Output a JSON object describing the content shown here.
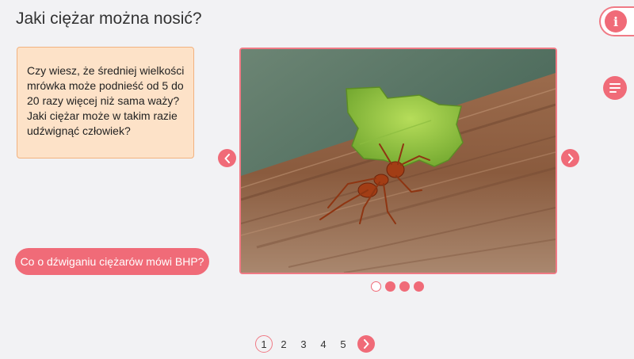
{
  "header": {
    "title": "Jaki ciężar można nosić?",
    "info_icon": "info-icon",
    "info_glyph": "i",
    "menu_icon": "hamburger-menu-icon"
  },
  "info_card": {
    "text": "Czy wiesz, że średniej wielkości mrówka może podnieść od 5 do 20 razy więcej niż sama waży? Jaki ciężar może w takim razie udźwignąć człowiek?"
  },
  "bhp_button": {
    "label": "Co o dźwiganiu ciężarów mówi BHP?"
  },
  "carousel": {
    "image_icon": "ant-carrying-leaf-image",
    "prev_icon": "chevron-left-icon",
    "next_icon": "chevron-right-icon",
    "slide_count": 4,
    "active_slide": 1
  },
  "pagination": {
    "pages": [
      "1",
      "2",
      "3",
      "4",
      "5"
    ],
    "current": "1",
    "next_icon": "chevron-right-icon"
  },
  "colors": {
    "accent": "#f06b78",
    "card_bg": "#fde2c8",
    "card_border": "#f2b27f",
    "page_bg": "#f2f2f4"
  }
}
